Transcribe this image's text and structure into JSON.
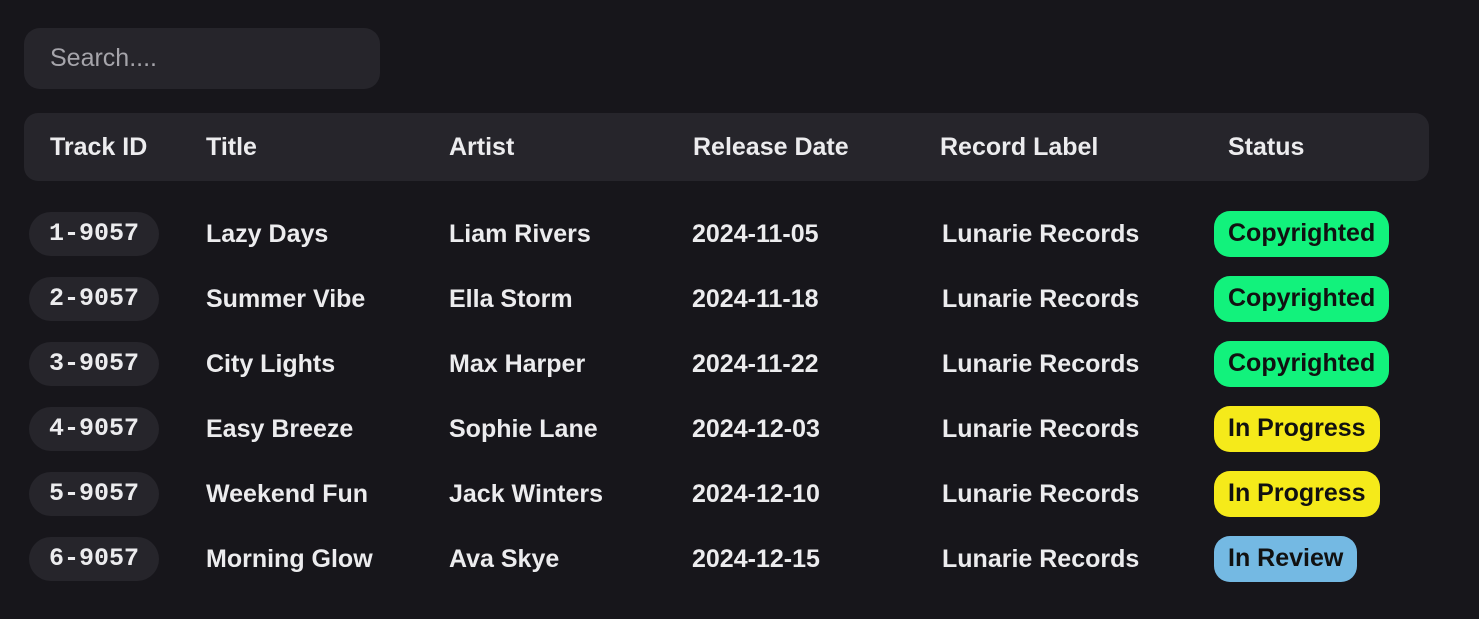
{
  "search": {
    "placeholder": "Search....",
    "value": ""
  },
  "table": {
    "columns": [
      "Track ID",
      "Title",
      "Artist",
      "Release Date",
      "Record Label",
      "Status"
    ],
    "rows": [
      {
        "id": "1-9057",
        "title": "Lazy Days",
        "artist": "Liam Rivers",
        "release_date": "2024-11-05",
        "label": "Lunarie Records",
        "status": "Copyrighted"
      },
      {
        "id": "2-9057",
        "title": "Summer Vibe",
        "artist": "Ella Storm",
        "release_date": "2024-11-18",
        "label": "Lunarie Records",
        "status": "Copyrighted"
      },
      {
        "id": "3-9057",
        "title": "City Lights",
        "artist": "Max Harper",
        "release_date": "2024-11-22",
        "label": "Lunarie Records",
        "status": "Copyrighted"
      },
      {
        "id": "4-9057",
        "title": "Easy Breeze",
        "artist": "Sophie Lane",
        "release_date": "2024-12-03",
        "label": "Lunarie Records",
        "status": "In Progress"
      },
      {
        "id": "5-9057",
        "title": "Weekend Fun",
        "artist": "Jack Winters",
        "release_date": "2024-12-10",
        "label": "Lunarie Records",
        "status": "In Progress"
      },
      {
        "id": "6-9057",
        "title": "Morning Glow",
        "artist": "Ava Skye",
        "release_date": "2024-12-15",
        "label": "Lunarie Records",
        "status": "In Review"
      }
    ]
  },
  "status_colors": {
    "Copyrighted": "#12f27c",
    "In Progress": "#f5ea1a",
    "In Review": "#74b9e3"
  }
}
